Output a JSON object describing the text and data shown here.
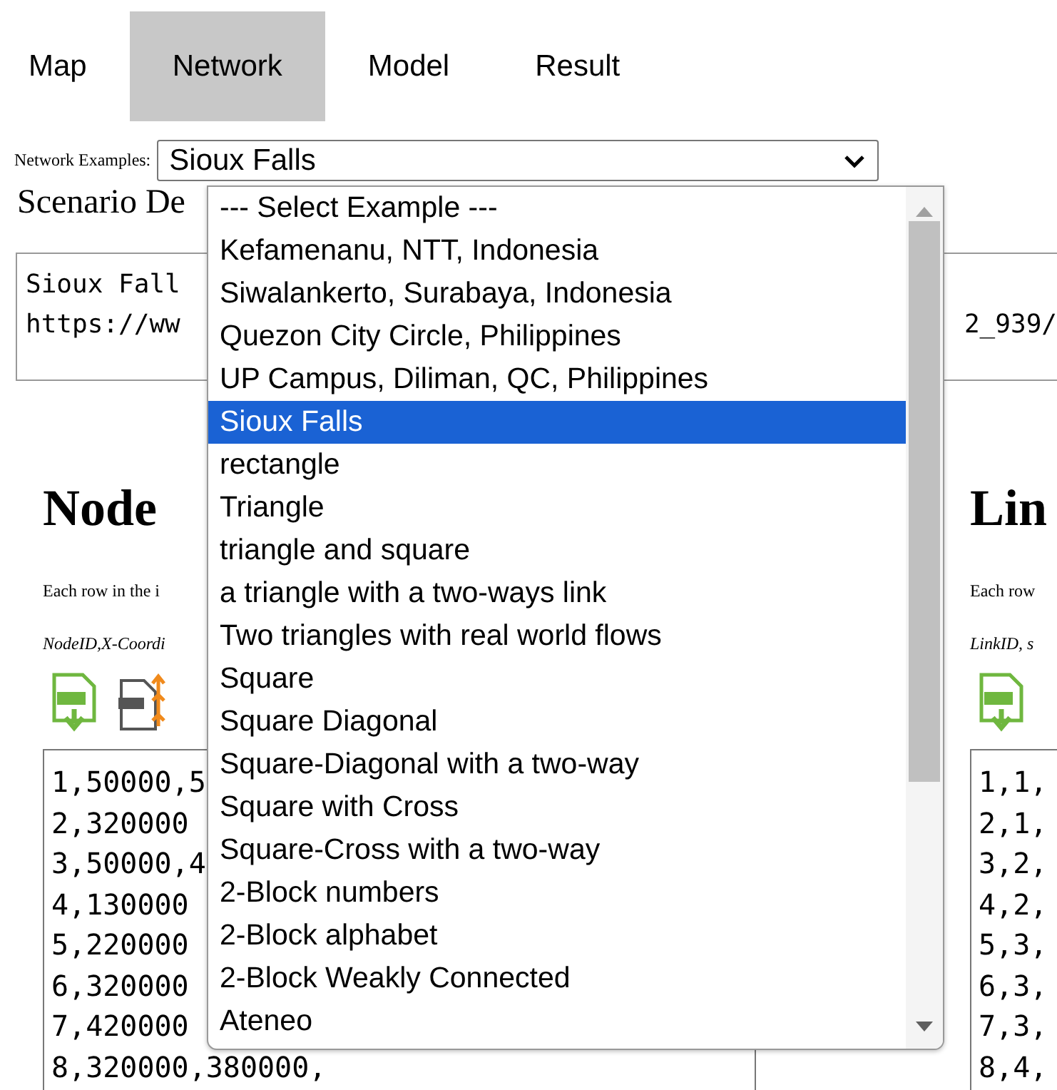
{
  "tabs": [
    {
      "label": "Map",
      "selected": false
    },
    {
      "label": "Network",
      "selected": true
    },
    {
      "label": "Model",
      "selected": false
    },
    {
      "label": "Result",
      "selected": false
    }
  ],
  "network_examples": {
    "label": "Network Examples:",
    "value": "Sioux Falls",
    "options": [
      {
        "label": "--- Select Example ---",
        "selected": false
      },
      {
        "label": "Kefamenanu, NTT, Indonesia",
        "selected": false
      },
      {
        "label": "Siwalankerto, Surabaya, Indonesia",
        "selected": false
      },
      {
        "label": "Quezon City Circle, Philippines",
        "selected": false
      },
      {
        "label": "UP Campus, Diliman, QC, Philippines",
        "selected": false
      },
      {
        "label": "Sioux Falls",
        "selected": true
      },
      {
        "label": "rectangle",
        "selected": false
      },
      {
        "label": "Triangle",
        "selected": false
      },
      {
        "label": "triangle and square",
        "selected": false
      },
      {
        "label": "a triangle with a two-ways link",
        "selected": false
      },
      {
        "label": "Two triangles with real world flows",
        "selected": false
      },
      {
        "label": "Square",
        "selected": false
      },
      {
        "label": "Square Diagonal",
        "selected": false
      },
      {
        "label": "Square-Diagonal with a two-way",
        "selected": false
      },
      {
        "label": "Square with Cross",
        "selected": false
      },
      {
        "label": "Square-Cross with a two-way",
        "selected": false
      },
      {
        "label": "2-Block numbers",
        "selected": false
      },
      {
        "label": "2-Block alphabet",
        "selected": false
      },
      {
        "label": "2-Block Weakly Connected",
        "selected": false
      },
      {
        "label": "Ateneo",
        "selected": false
      }
    ]
  },
  "scenario": {
    "heading": "Scenario De",
    "lines": [
      "Sioux Fall",
      "https://ww"
    ],
    "right_text": "2_939/"
  },
  "node_panel": {
    "heading": "Node",
    "description": "Each row in the i",
    "format": "NodeID,X-Coordi",
    "rows": [
      "1,50000,5",
      "2,320000",
      "3,50000,4",
      "4,130000",
      "5,220000",
      "6,320000",
      "7,420000",
      "8,320000,380000,"
    ]
  },
  "link_panel": {
    "heading": "Lin",
    "description": "Each row",
    "format": "LinkID, s",
    "rows": [
      "1,1,",
      "2,1,",
      "3,2,",
      "4,2,",
      "5,3,",
      "6,3,",
      "7,3,",
      "8,4,"
    ]
  }
}
